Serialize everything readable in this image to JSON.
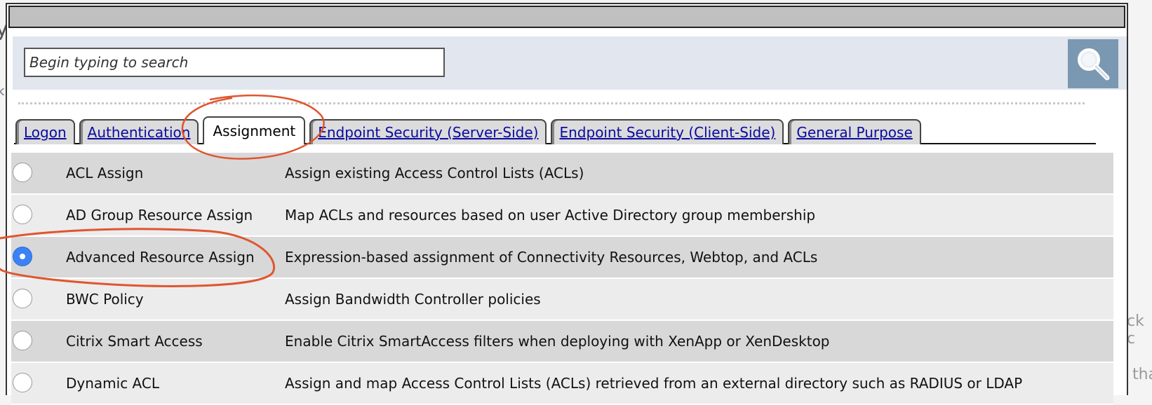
{
  "background": {
    "left_fragment": "y",
    "left_fragment_2": "k",
    "right_fragment_1": "ck c",
    "right_fragment_2": "tha"
  },
  "search": {
    "placeholder": "Begin typing to search",
    "value": "",
    "button_icon": "magnifier-icon"
  },
  "tabs": [
    {
      "label": "Logon",
      "active": false
    },
    {
      "label": "Authentication",
      "active": false
    },
    {
      "label": "Assignment",
      "active": true
    },
    {
      "label": "Endpoint Security (Server-Side)",
      "active": false
    },
    {
      "label": "Endpoint Security (Client-Side)",
      "active": false
    },
    {
      "label": "General Purpose",
      "active": false
    }
  ],
  "items": [
    {
      "name": "ACL Assign",
      "description": "Assign existing Access Control Lists (ACLs)",
      "selected": false
    },
    {
      "name": "AD Group Resource Assign",
      "description": "Map ACLs and resources based on user Active Directory group membership",
      "selected": false
    },
    {
      "name": "Advanced Resource Assign",
      "description": "Expression-based assignment of Connectivity Resources, Webtop, and ACLs",
      "selected": true
    },
    {
      "name": "BWC Policy",
      "description": "Assign Bandwidth Controller policies",
      "selected": false
    },
    {
      "name": "Citrix Smart Access",
      "description": "Enable Citrix SmartAccess filters when deploying with XenApp or XenDesktop",
      "selected": false
    },
    {
      "name": "Dynamic ACL",
      "description": "Assign and map Access Control Lists (ACLs) retrieved from an external directory such as RADIUS or LDAP",
      "selected": false
    }
  ],
  "colors": {
    "search_button": "#7b98b2",
    "tab_link": "#0a0aa0",
    "radio_checked": "#3b82f6",
    "annotation": "#e0552f"
  }
}
